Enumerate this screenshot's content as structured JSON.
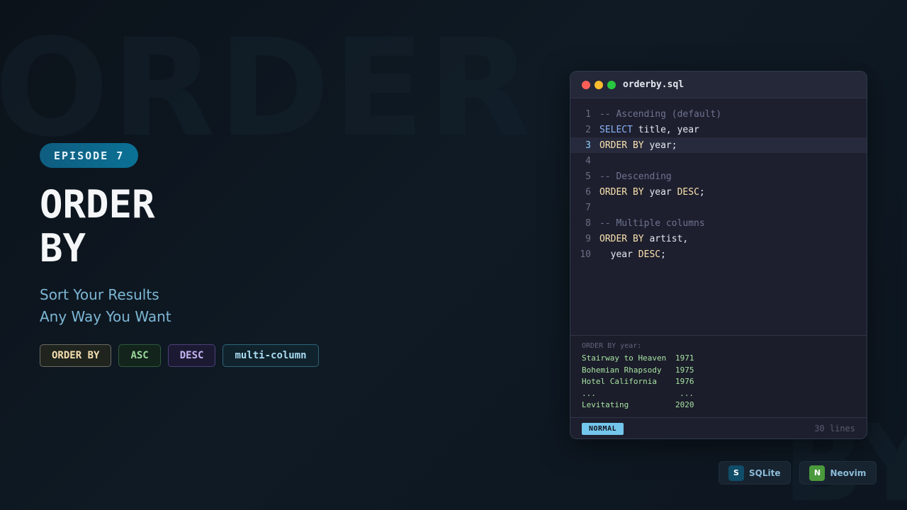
{
  "background": {
    "word_top": "ORDER",
    "word_bottom": "BY"
  },
  "episode": {
    "label": "EPISODE 7"
  },
  "title": {
    "line1": "ORDER",
    "line2": "BY"
  },
  "subtitle": {
    "line1": "Sort Your Results",
    "line2": "Any Way You Want"
  },
  "tags": [
    "ORDER BY",
    "ASC",
    "DESC",
    "multi-column"
  ],
  "editor": {
    "filename": "orderby.sql",
    "lines": [
      {
        "num": "1",
        "tokens": [
          {
            "t": "-- Ascending (default)",
            "c": "comment"
          }
        ]
      },
      {
        "num": "2",
        "tokens": [
          {
            "t": "SELECT",
            "c": "select"
          },
          {
            "t": " title, year",
            "c": "id"
          }
        ]
      },
      {
        "num": "3",
        "active": true,
        "tokens": [
          {
            "t": "ORDER BY",
            "c": "kw"
          },
          {
            "t": " year;",
            "c": "id"
          }
        ]
      },
      {
        "num": "4",
        "tokens": []
      },
      {
        "num": "5",
        "tokens": [
          {
            "t": "-- Descending",
            "c": "comment"
          }
        ]
      },
      {
        "num": "6",
        "tokens": [
          {
            "t": "ORDER BY",
            "c": "kw"
          },
          {
            "t": " year ",
            "c": "id"
          },
          {
            "t": "DESC",
            "c": "kw"
          },
          {
            "t": ";",
            "c": "id"
          }
        ]
      },
      {
        "num": "7",
        "tokens": []
      },
      {
        "num": "8",
        "tokens": [
          {
            "t": "-- Multiple columns",
            "c": "comment"
          }
        ]
      },
      {
        "num": "9",
        "tokens": [
          {
            "t": "ORDER BY",
            "c": "kw"
          },
          {
            "t": " artist,",
            "c": "id"
          }
        ]
      },
      {
        "num": "10",
        "tokens": [
          {
            "t": "  year ",
            "c": "id"
          },
          {
            "t": "DESC",
            "c": "kw"
          },
          {
            "t": ";",
            "c": "id"
          }
        ]
      }
    ],
    "results": {
      "title": "ORDER BY year:",
      "rows": [
        [
          "Stairway to Heaven",
          "1971"
        ],
        [
          "Bohemian Rhapsody",
          "1975"
        ],
        [
          "Hotel California",
          "1976"
        ],
        [
          "...",
          "..."
        ],
        [
          "Levitating",
          "2020"
        ]
      ]
    },
    "status": {
      "mode": "NORMAL",
      "line_count": "30 lines"
    }
  },
  "tools": [
    {
      "icon_letter": "S",
      "label": "SQLite",
      "icon": "sqlite-icon"
    },
    {
      "icon_letter": "N",
      "label": "Neovim",
      "icon": "neovim-icon"
    }
  ],
  "colors": {
    "accent": "#0a7195",
    "keyword": "#f9e2af",
    "select_keyword": "#89b4fa",
    "comment": "#6e7390",
    "result_text": "#a6e3a1",
    "mode_badge": "#74c7ec"
  }
}
